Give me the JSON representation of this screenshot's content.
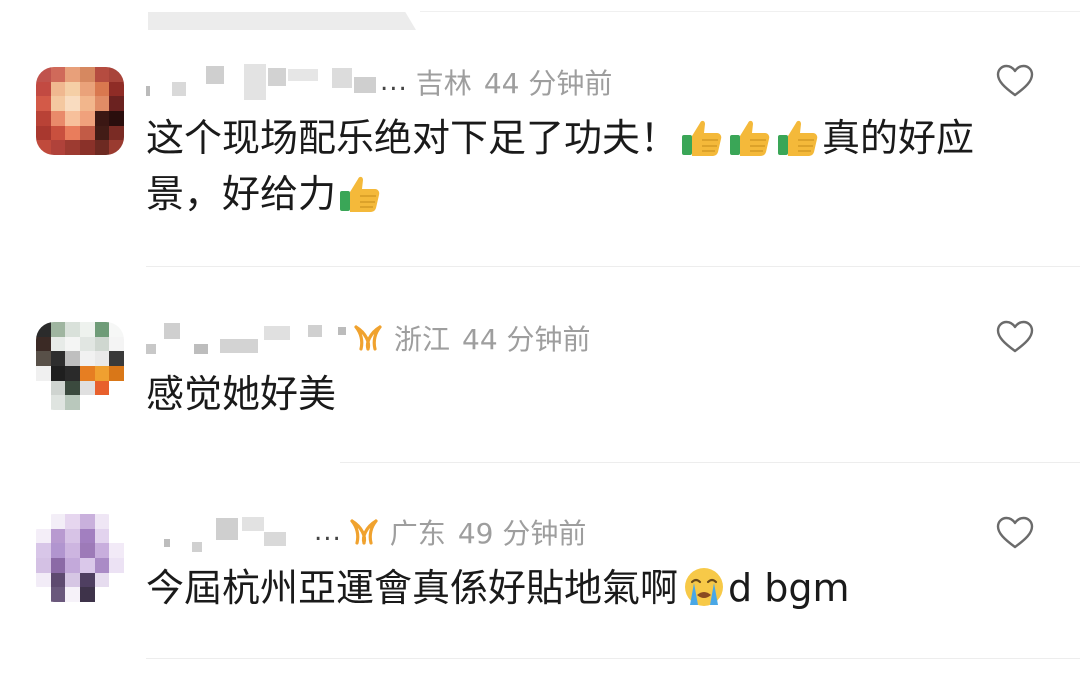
{
  "comments": [
    {
      "username_tail": "...",
      "region": "吉林",
      "time": "44 分钟前",
      "text_prefix": "这个现场配乐绝对下足了功夫！",
      "text_mid": "真的好应景，好给力",
      "thumb_icon": "thumbs-up-emoji",
      "has_badge": false
    },
    {
      "username_tail": "",
      "region": "浙江",
      "time": "44 分钟前",
      "text": "感觉她好美",
      "has_badge": true
    },
    {
      "username_tail": "...",
      "region": "广东",
      "time": "49 分钟前",
      "text_prefix": "今屆杭州亞運會真係好貼地氣啊",
      "text_suffix": "d bgm",
      "emoji_icon": "loudly-crying-face-emoji",
      "has_badge": true
    }
  ],
  "colors": {
    "text": "#1a1a1a",
    "meta": "#9e9e9e",
    "badge": "#f0a22e",
    "like": "#6b6b6b",
    "divider": "#ededed"
  }
}
